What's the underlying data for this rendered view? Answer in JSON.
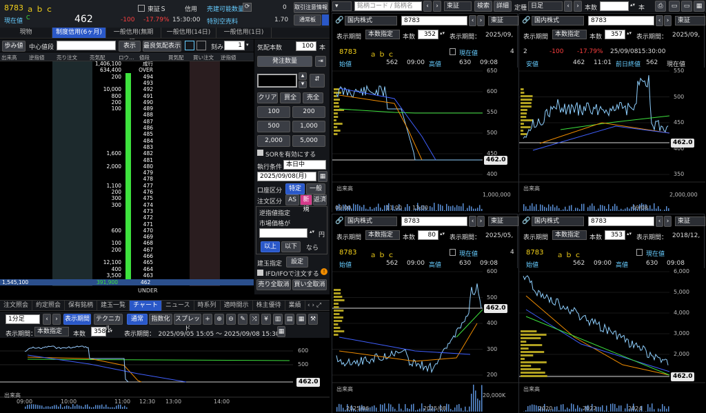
{
  "stock": {
    "code": "8783",
    "name": "ａｂｃ",
    "market": "東証Ｓ",
    "margin": "信用",
    "price": "462",
    "change": "-100",
    "change_pct": "-17.79%",
    "time": "15:30:00",
    "status_label": "現在値",
    "status_c": "C",
    "sell_avail": "売建可能数量",
    "sell_avail_val": "0",
    "premium": "特別空売料",
    "premium_val": "1.70",
    "notice_btn": "取引注意情報",
    "normal_btn": "通常板"
  },
  "order_tabs": [
    "現物",
    "制度信用(6ヶ月)",
    "一般信用(無期限)",
    "一般信用(14日)",
    "一般信用(1日)"
  ],
  "board_toolbar": {
    "ayumi": "歩み値",
    "center": "中心値段",
    "show": "表示",
    "best": "最良気配表示",
    "step_label": "刻み",
    "step_val": "1"
  },
  "ladder_headers": [
    "出来高",
    "逆指値",
    "売り注文",
    "売気配",
    "ロウ…",
    "値段",
    "買気配",
    "買い注文",
    "逆指値"
  ],
  "ladder_rows": [
    {
      "sell": "1,406,100",
      "price": "成行"
    },
    {
      "sell": "634,400",
      "price": "OVER"
    },
    {
      "sell": "200",
      "price": "494"
    },
    {
      "sell": "",
      "price": "493"
    },
    {
      "sell": "10,000",
      "price": "492"
    },
    {
      "sell": "800",
      "price": "491"
    },
    {
      "sell": "200",
      "price": "490"
    },
    {
      "sell": "100",
      "price": "489"
    },
    {
      "sell": "",
      "price": "488"
    },
    {
      "sell": "",
      "price": "487"
    },
    {
      "sell": "",
      "price": "486"
    },
    {
      "sell": "",
      "price": "485"
    },
    {
      "sell": "",
      "price": "484"
    },
    {
      "sell": "",
      "price": "483"
    },
    {
      "sell": "1,600",
      "price": "482"
    },
    {
      "sell": "",
      "price": "481"
    },
    {
      "sell": "2,000",
      "price": "480"
    },
    {
      "sell": "",
      "price": "479"
    },
    {
      "sell": "",
      "price": "478"
    },
    {
      "sell": "1,100",
      "price": "477"
    },
    {
      "sell": "200",
      "price": "476"
    },
    {
      "sell": "300",
      "price": "475"
    },
    {
      "sell": "300",
      "price": "474"
    },
    {
      "sell": "",
      "price": "473"
    },
    {
      "sell": "",
      "price": "472"
    },
    {
      "sell": "",
      "price": "471"
    },
    {
      "sell": "600",
      "price": "470"
    },
    {
      "sell": "",
      "price": "469"
    },
    {
      "sell": "100",
      "price": "468"
    },
    {
      "sell": "200",
      "price": "467"
    },
    {
      "sell": "",
      "price": "466"
    },
    {
      "sell": "12,100",
      "price": "465"
    },
    {
      "sell": "400",
      "price": "464"
    },
    {
      "sell": "3,500",
      "price": "463"
    }
  ],
  "ladder_bottom": {
    "volume": "1,545,100",
    "sell": "391,900",
    "price": "462",
    "under": "UNDER"
  },
  "order_panel": {
    "kehai_label": "気配本数",
    "kehai_val": "100",
    "kehai_unit": "本",
    "submit": "発注数量",
    "clear": "クリア",
    "all_buy": "買全",
    "all_sell": "売全",
    "qty": [
      "100",
      "200",
      "500",
      "1,000",
      "2,000",
      "5,000"
    ],
    "sor": "SORを有効にする",
    "exec_label": "執行条件",
    "exec_val": "本日中",
    "date": "2025/09/08(月)",
    "account_label": "口座区分",
    "acc1": "特定",
    "acc2": "一般",
    "order_label": "注文区分",
    "ord1": "AS",
    "ord2": "新規",
    "ord3": "返済",
    "stop_title": "逆指値指定",
    "stop_market": "市場価格が",
    "yen": "円",
    "above": "以上",
    "below": "以下",
    "nara": "なら",
    "pos_label": "建玉指定",
    "setting": "設定",
    "ifd": "IFD/IFOで注文する",
    "cancel_sell": "売り全取消",
    "cancel_buy": "買い全取消"
  },
  "bottom_tabs": [
    "注文照会",
    "約定照会",
    "保有銘柄",
    "建玉一覧",
    "チャート",
    "ニュース",
    "時系列",
    "適時開示",
    "株主優待",
    "業績"
  ],
  "chart_tool": {
    "interval": "1分足",
    "period_btn": "表示期間",
    "tech": "テクニカル",
    "normal": "通常",
    "index": "指数化",
    "spread": "スプレッド",
    "period_label": "表示期間：",
    "period_sel": "本数指定",
    "count_label": "本数",
    "count": "358",
    "range": "表示期間：　2025/09/05 15:05 ～ 2025/09/08 15:30",
    "volume": "出来高"
  },
  "main_chart": {
    "x": [
      "09:00",
      "10:00",
      "11:00",
      "12:30",
      "13:00",
      "14:00"
    ],
    "y": [
      "600",
      "500"
    ],
    "price": "462.0"
  },
  "right_top": {
    "search_ph": "銘柄コード / 銘柄名",
    "market": "東証",
    "search": "検索",
    "detail": "詳細",
    "teiki": "定種",
    "interval": "日足",
    "count_label": "本数",
    "unit": "本"
  },
  "charts": [
    {
      "market": "国内株式",
      "code": "8783",
      "exch": "東証",
      "period": "本数指定",
      "count_label": "本数",
      "count": "352",
      "date": "2025/09,",
      "row1": [
        "8783",
        "ａｂｃ",
        "現在値",
        "4"
      ],
      "row2": [
        "始値",
        "562",
        "09:00",
        "高値",
        "630",
        "09:08"
      ],
      "y": [
        "650",
        "600",
        "550",
        "500",
        "450",
        "400"
      ],
      "vol_label": "出来高",
      "vol_y": "1,000,000",
      "x": [
        "09:00",
        "11:00",
        "13:00"
      ],
      "price": "462.0"
    },
    {
      "market": "国内株式",
      "code": "8783",
      "exch": "東証",
      "period": "本数指定",
      "count_label": "本数",
      "count": "357",
      "date": "2025/09,",
      "row1": [
        "2",
        "-100",
        "-17.79%",
        "25/09/08",
        "15:30:00"
      ],
      "row2": [
        "安値",
        "462",
        "11:01",
        "前日終値",
        "562",
        "現在値"
      ],
      "y": [
        "550",
        "500",
        "450",
        "400",
        "350"
      ],
      "vol_label": "出来高",
      "vol_y": "2,000,000",
      "x": [
        "09/08"
      ],
      "price": "462.0"
    },
    {
      "market": "国内株式",
      "code": "8783",
      "exch": "東証",
      "period": "本数指定",
      "count_label": "本数",
      "count": "80",
      "date": "2025/05,",
      "row1": [
        "8783",
        "ａｂｃ",
        "現在値",
        "4"
      ],
      "row2": [
        "始値",
        "562",
        "09:00",
        "高値",
        "630",
        "09:08"
      ],
      "y": [
        "600",
        "500",
        "400",
        "300",
        "200"
      ],
      "vol_label": "出来高",
      "vol_y": "20,000K",
      "x": [
        "2025/06",
        "2025/08"
      ],
      "price": "462.0"
    },
    {
      "market": "国内株式",
      "code": "8783",
      "exch": "東証",
      "period": "本数指定",
      "count_label": "本数",
      "count": "353",
      "date": "2018/12,",
      "row1": [
        "8783",
        "ａｂｃ",
        "現在値"
      ],
      "row2": [
        "始値",
        "562",
        "09:00",
        "高値",
        "630",
        "09:08"
      ],
      "y": [
        "6,000",
        "5,000",
        "4,000",
        "3,000",
        "2,000",
        "1,000"
      ],
      "vol_label": "出来高",
      "vol_y": "",
      "x": [
        "2020",
        "2022",
        "2024"
      ],
      "price": "462.0"
    }
  ],
  "colors": {
    "accent": "#2a58c8",
    "up": "#3ee23e",
    "down": "#ff4040",
    "ticker": "#f5d21a",
    "bar": "#3ee23e"
  }
}
